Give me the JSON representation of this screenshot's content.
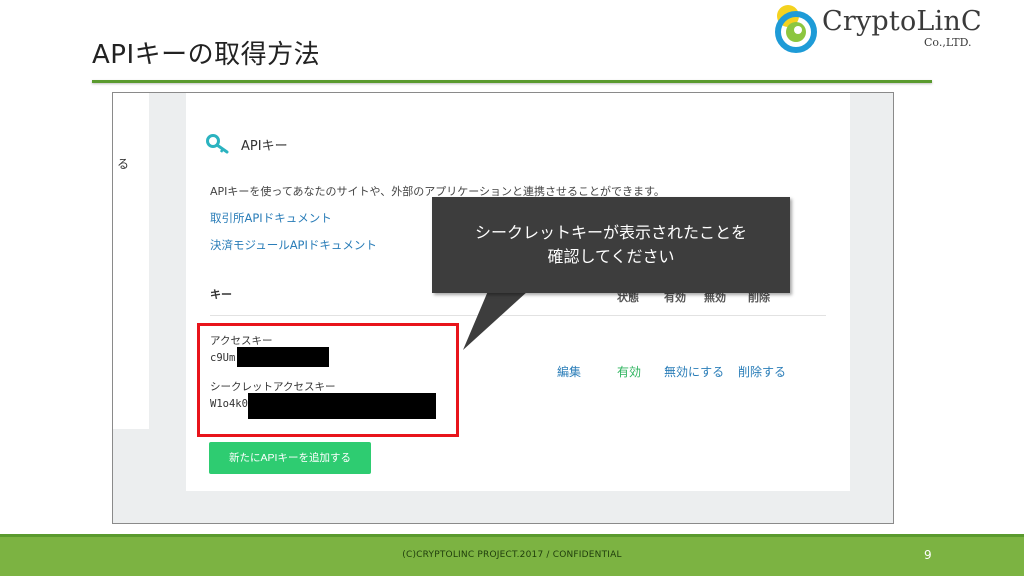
{
  "slide": {
    "title": "APIキーの取得方法",
    "page_number": "9",
    "footer": "(C)CRYPTOLINC PROJECT.2017 / CONFIDENTIAL"
  },
  "logo": {
    "name": "CryptoLinC",
    "sub": "Co.,LTD."
  },
  "screenshot": {
    "left_fragment": "る",
    "heading": "APIキー",
    "description": "APIキーを使ってあなたのサイトや、外部のアプリケーションと連携させることができます。",
    "links": [
      "取引所APIドキュメント",
      "決済モジュールAPIドキュメント"
    ],
    "table": {
      "key_header": "キー",
      "columns": [
        "状態",
        "有効",
        "無効",
        "削除"
      ]
    },
    "access_key_label": "アクセスキー",
    "access_key_value": "c9Um",
    "secret_key_label": "シークレットアクセスキー",
    "secret_key_value": "W1o4k0",
    "actions": {
      "edit": "編集",
      "status": "有効",
      "disable": "無効にする",
      "delete": "削除する"
    },
    "add_button": "新たにAPIキーを追加する"
  },
  "callout": {
    "line1": "シークレットキーが表示されたことを",
    "line2": "確認してください"
  },
  "colors": {
    "accent_green": "#7cb342",
    "rule_green": "#5a9a2e",
    "button_green": "#2ecc71",
    "link_blue": "#2a7db8",
    "highlight_red": "#e8141b",
    "callout_bg": "#3d3d3d"
  }
}
